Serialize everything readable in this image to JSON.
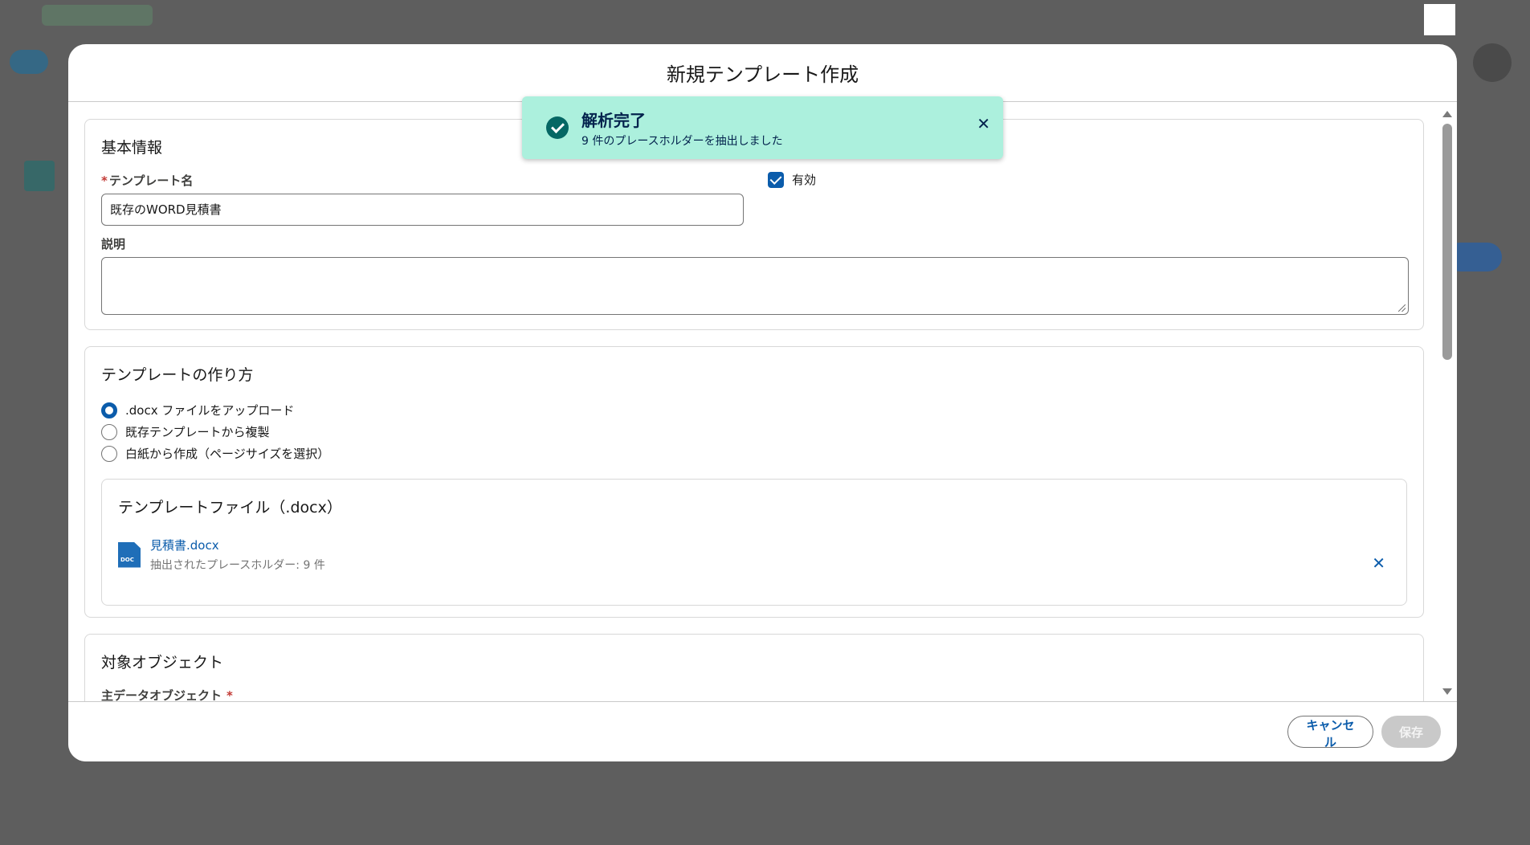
{
  "modal": {
    "title": "新規テンプレート作成"
  },
  "basic": {
    "section_title": "基本情報",
    "name_label": "テンプレート名",
    "name_value": "既存のWORD見積書",
    "active_label": "有効",
    "active_checked": true,
    "description_label": "説明",
    "description_value": ""
  },
  "creation": {
    "section_title": "テンプレートの作り方",
    "options": [
      {
        "label": ".docx ファイルをアップロード",
        "checked": true
      },
      {
        "label": "既存テンプレートから複製",
        "checked": false
      },
      {
        "label": "白紙から作成（ページサイズを選択）",
        "checked": false
      }
    ],
    "file_section_title": "テンプレートファイル（.docx）",
    "file_name": "見積書.docx",
    "file_meta": "抽出されたプレースホルダー: 9 件",
    "doc_badge": "DOC"
  },
  "target": {
    "section_title": "対象オブジェクト",
    "primary_label": "主データオブジェクト"
  },
  "footer": {
    "cancel_label": "キャンセル",
    "save_label": "保存"
  },
  "toast": {
    "title": "解析完了",
    "message": "9 件のプレースホルダーを抽出しました"
  },
  "colors": {
    "brand": "#0b5cab",
    "toast_bg": "#acf0dd",
    "toast_icon": "#056764",
    "required": "#c23934"
  }
}
